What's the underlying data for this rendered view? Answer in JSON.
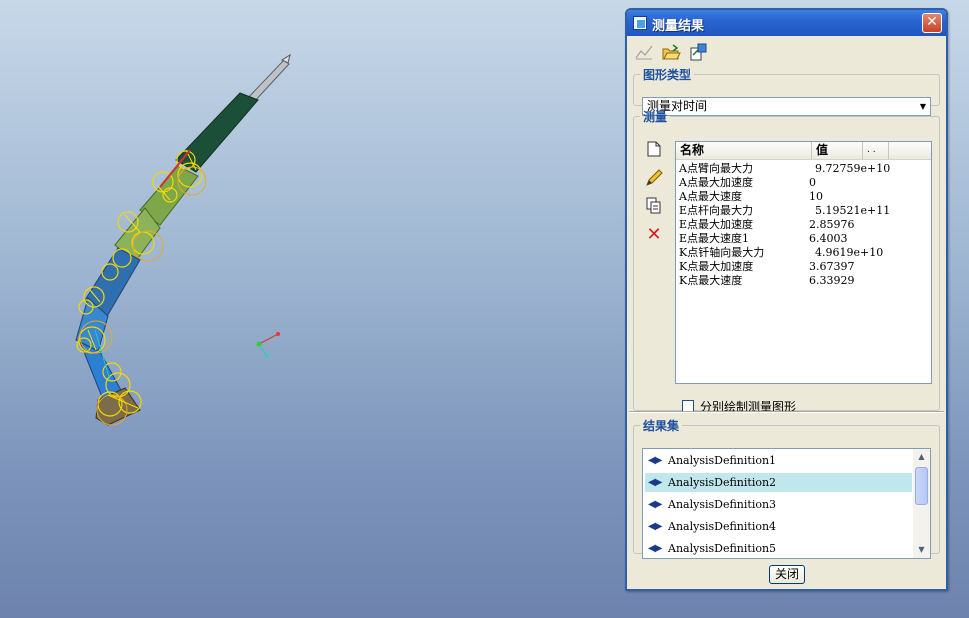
{
  "dialog": {
    "title": "测量结果",
    "graph_type": {
      "legend": "图形类型",
      "selected": "测量对时间"
    },
    "measure": {
      "legend": "测量",
      "columns": [
        "名称",
        "值",
        ". ."
      ],
      "rows": [
        {
          "name": "A点臂向最大力",
          "value": "9.72759e+10"
        },
        {
          "name": "A点最大加速度",
          "value": "0"
        },
        {
          "name": "A点最大速度",
          "value": "10"
        },
        {
          "name": "E点杆向最大力",
          "value": "5.19521e+11"
        },
        {
          "name": "E点最大加速度",
          "value": "2.85976"
        },
        {
          "name": "E点最大速度1",
          "value": "6.4003"
        },
        {
          "name": "K点钎轴向最大力",
          "value": "4.9619e+10"
        },
        {
          "name": "K点最大加速度",
          "value": "3.67397"
        },
        {
          "name": "K点最大速度",
          "value": "6.33929"
        }
      ],
      "separate_checkbox_label": "分别绘制测量图形",
      "separate_checked": false
    },
    "results": {
      "legend": "结果集",
      "items": [
        {
          "label": "AnalysisDefinition1",
          "selected": false
        },
        {
          "label": "AnalysisDefinition2",
          "selected": true
        },
        {
          "label": "AnalysisDefinition3",
          "selected": false
        },
        {
          "label": "AnalysisDefinition4",
          "selected": false
        },
        {
          "label": "AnalysisDefinition5",
          "selected": false
        }
      ]
    },
    "close_label": "关闭"
  },
  "icons": {
    "toolbar": [
      "graph-icon",
      "open-folder-icon",
      "export-icon"
    ],
    "side": [
      "new-icon",
      "edit-icon",
      "copy-icon",
      "delete-icon"
    ]
  }
}
